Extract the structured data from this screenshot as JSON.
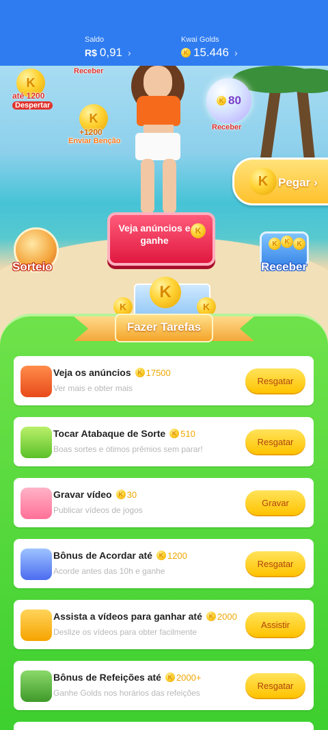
{
  "header": {
    "saldo_label": "Saldo",
    "saldo_currency": "R$",
    "saldo_value": "0,91",
    "gold_label": "Kwai Golds",
    "gold_value": "15.446",
    "chevron": "›"
  },
  "scene": {
    "receber_top_label": "Receber",
    "despertar_amount": "até 1200",
    "despertar_label": "Despertar",
    "bencao_amount": "+1200",
    "bencao_label": "Enviar Benção",
    "bubble_value": "80",
    "bubble_label": "Receber",
    "pegar_label": "Pegar",
    "pegar_chevron": "›",
    "ads_button_label": "Veja anúncios e ganhe",
    "sorteio_label": "Sorteio",
    "receber_label": "Receber",
    "banner_label": "Fazer Tarefas",
    "coin_letter": "K"
  },
  "tasks": [
    {
      "title": "Veja os anúncios",
      "reward": "17500",
      "subtitle": "Ver mais e obter mais",
      "button": "Resgatar",
      "icon": "tv-icon"
    },
    {
      "title": "Tocar Atabaque de Sorte",
      "reward": "510",
      "subtitle": "Boas sortes e ótimos prêmios sem parar!",
      "button": "Resgatar",
      "icon": "drum-icon"
    },
    {
      "title": "Gravar vídeo",
      "reward": "30",
      "subtitle": "Publicar vídeos de jogos",
      "button": "Gravar",
      "icon": "camera-icon"
    },
    {
      "title": "Bônus de Acordar até",
      "reward": "1200",
      "subtitle": "Acorde antes das 10h e ganhe",
      "button": "Resgatar",
      "icon": "alarm-icon"
    },
    {
      "title": "Assista a vídeos para ganhar até",
      "reward": "2000",
      "subtitle": "Deslize os vídeos para obter facilmente",
      "button": "Assistir",
      "icon": "video-camera-icon"
    },
    {
      "title": "Bônus de Refeições até",
      "reward": "2000+",
      "subtitle": "Ganhe Golds nos horários das refeições",
      "button": "Resgatar",
      "icon": "lunchbox-icon"
    }
  ]
}
